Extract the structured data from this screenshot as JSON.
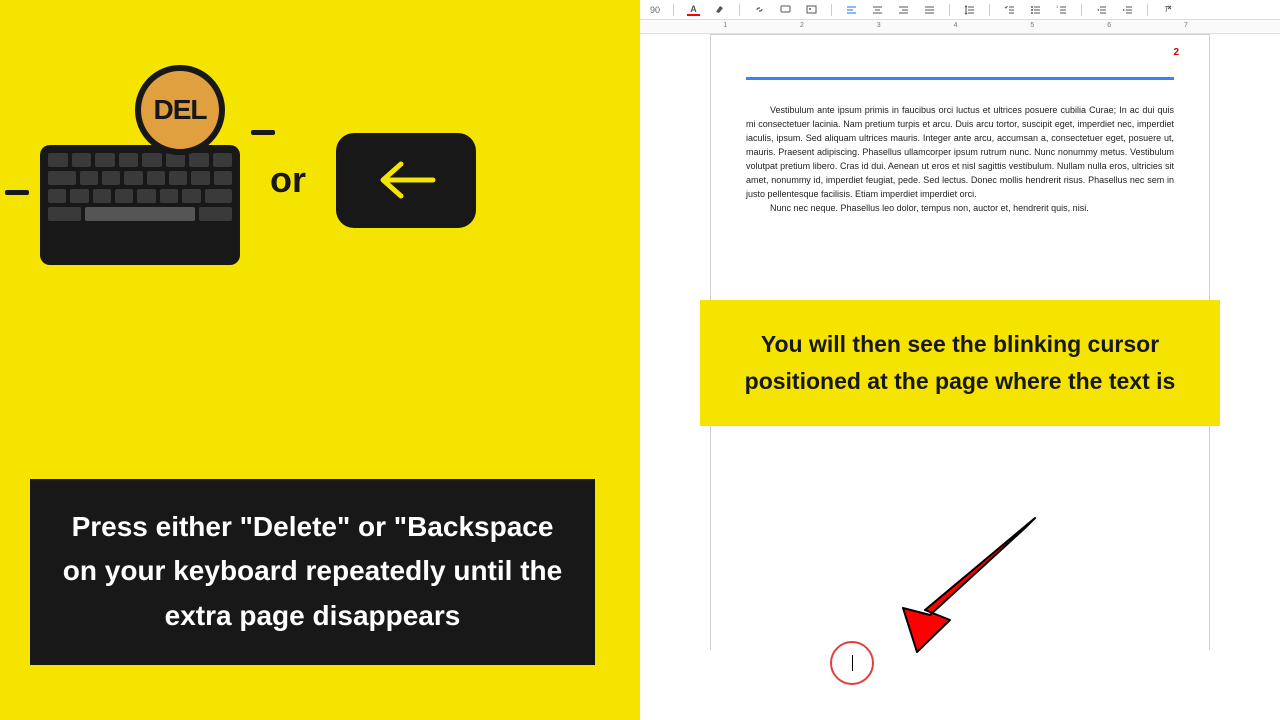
{
  "left": {
    "del_label": "DEL",
    "or": "or",
    "caption": "Press either \"Delete\" or \"Backspace on your keyboard repeatedly until the extra page disappears"
  },
  "right": {
    "zoom": "90",
    "page_number": "2",
    "body_p1": "Vestibulum ante ipsum primis in faucibus orci luctus et ultrices posuere cubilia Curae; In ac dui quis mi consectetuer lacinia. Nam pretium turpis et arcu. Duis arcu tortor, suscipit eget, imperdiet nec, imperdiet iaculis, ipsum. Sed aliquam ultrices mauris. Integer ante arcu, accumsan a, consectetuer eget, posuere ut, mauris. Praesent adipiscing. Phasellus ullamcorper ipsum rutrum nunc. Nunc nonummy metus. Vestibulum volutpat pretium libero. Cras id dui. Aenean ut eros et nisl sagittis vestibulum. Nullam nulla eros, ultricies sit amet, nonummy id, imperdiet feugiat, pede. Sed lectus. Donec mollis hendrerit risus. Phasellus nec sem in justo pellentesque facilisis. Etiam imperdiet imperdiet orci.",
    "body_p2": "Nunc nec neque. Phasellus leo dolor, tempus non, auctor et, hendrerit quis, nisi.",
    "caption": "You will then see the blinking cursor positioned at the page where the text is",
    "ruler": [
      "1",
      "2",
      "3",
      "4",
      "5",
      "6",
      "7"
    ]
  }
}
